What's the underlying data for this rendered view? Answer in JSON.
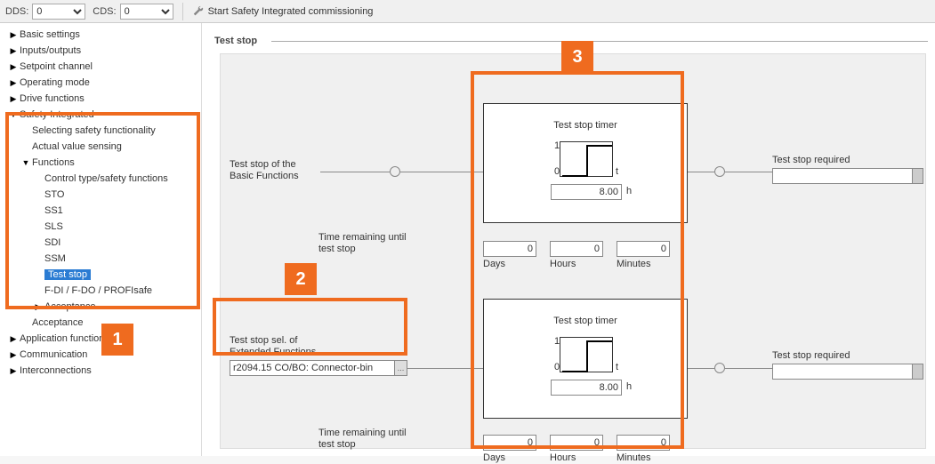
{
  "toolbar": {
    "dds_label": "DDS:",
    "dds_value": "0",
    "cds_label": "CDS:",
    "cds_value": "0",
    "safety_tool": "Start Safety Integrated commissioning"
  },
  "tree": {
    "basic": "Basic settings",
    "inputs": "Inputs/outputs",
    "setpoint": "Setpoint channel",
    "opmode": "Operating mode",
    "drivefn": "Drive functions",
    "safety": "Safety Integrated",
    "sel_safety": "Selecting safety functionality",
    "actual_val": "Actual value sensing",
    "functions": "Functions",
    "ctrl_type": "Control type/safety functions",
    "sto": "STO",
    "ss1": "SS1",
    "sls": "SLS",
    "sdi": "SDI",
    "ssm": "SSM",
    "teststop": "Test stop",
    "fdi": "F-DI / F-DO / PROFIsafe",
    "acceptance": "Acceptance",
    "acceptance2": "Acceptance",
    "appfn": "Application functions",
    "comm": "Communication",
    "intercon": "Interconnections"
  },
  "panel": {
    "title": "Test stop",
    "basic_label": "Test stop of the\nBasic Functions",
    "timer_label": "Test stop timer",
    "timer_value": "8.00",
    "timer_unit": "h",
    "required_label": "Test stop required",
    "remaining_label": "Time remaining until\ntest stop",
    "days": "Days",
    "hours": "Hours",
    "minutes": "Minutes",
    "zero": "0",
    "ext_label": "Test stop sel. of\nExtended Functions",
    "param_value": "r2094.15 CO/BO: Connector-bin",
    "axis1": "1",
    "axis0": "0",
    "axist": "t"
  },
  "annotations": {
    "n1": "1",
    "n2": "2",
    "n3": "3"
  }
}
